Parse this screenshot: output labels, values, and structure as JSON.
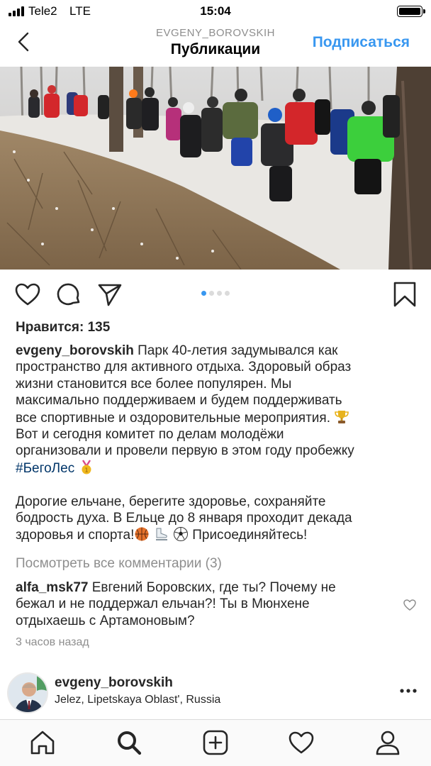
{
  "status_bar": {
    "carrier": "Tele2",
    "network": "LTE",
    "time": "15:04",
    "battery_level": 1.0
  },
  "nav": {
    "username": "EVGENY_BOROVSKIH",
    "title": "Публикации",
    "follow_label": "Подписаться",
    "back_icon": "chevron-left-icon"
  },
  "post": {
    "image_icon": "photo",
    "carousel": {
      "count": 4,
      "active_index": 0
    },
    "likes": "Нравится: 135",
    "caption": {
      "username": "evgeny_borovskih",
      "line_1": "Парк 40-летия задумывался как",
      "line_2": "пространство для активного отдыха.  Здоровый образ",
      "line_3": "жизни становится все более популярен. Мы",
      "line_4": "максимально поддерживаем и будем поддерживать",
      "line_5": "все спортивные и оздоровительные мероприятия.",
      "line_6": "Вот и сегодня комитет по делам  молодёжи",
      "line_7": "организовали и провели первую в этом году пробежку",
      "hashtag": "#БегоЛес",
      "line_8": "Дорогие ельчане, берегите здоровье, сохраняйте",
      "line_9": "бодрость духа. В Ельце до 8 января проходит декада",
      "line_10_start": "здоровья и спорта!",
      "line_10_end": " Присоединяйтесь!",
      "emoji": [
        "trophy",
        "medal",
        "basketball",
        "ice-skate",
        "soccer-ball"
      ]
    },
    "view_comments": "Посмотреть все комментарии (3)",
    "comment": {
      "username": "alfa_msk77",
      "line_1": "Евгений Боровских, где ты? Почему не",
      "line_2": "бежал и не поддержал ельчан?! Ты в Мюнхене",
      "line_3": "отдыхаешь с Артамоновым?"
    },
    "timestamp": "3 часов назад"
  },
  "author": {
    "username": "evgeny_borovskih",
    "location": "Jelez, Lipetskaya Oblast', Russia"
  },
  "tab_bar": {
    "items": [
      "home-icon",
      "search-icon",
      "add-post-icon",
      "activity-heart-icon",
      "profile-icon"
    ],
    "active": "search-icon"
  },
  "colors": {
    "accent": "#3897f0",
    "hashtag": "#003569",
    "secondary_text": "#8e8e8e",
    "carousel_active_dot": "#3897f0"
  }
}
